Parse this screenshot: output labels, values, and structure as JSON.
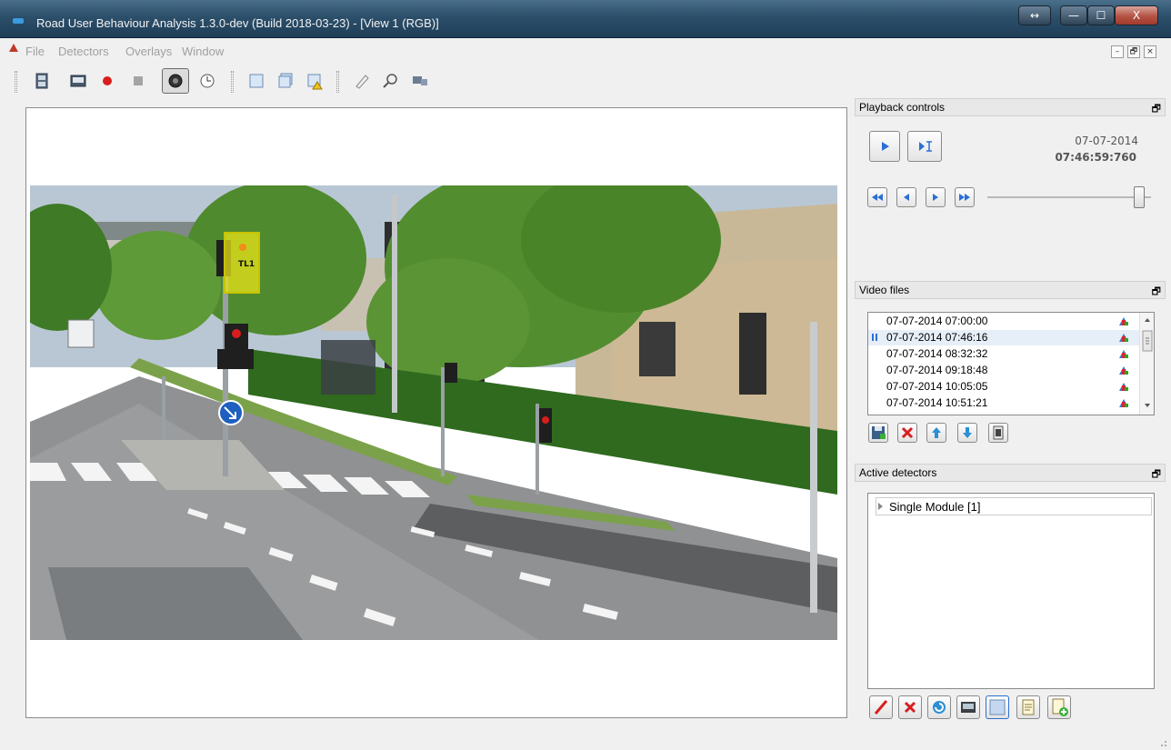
{
  "window": {
    "title": "Road User Behaviour Analysis 1.3.0-dev (Build 2018-03-23) - [View 1 (RGB)]",
    "resize_glyph": "↔",
    "min_glyph": "—",
    "max_glyph": "☐",
    "close_glyph": "X"
  },
  "menu": {
    "items": [
      "File",
      "Detectors",
      "Overlays",
      "Window"
    ]
  },
  "mdi_controls": {
    "minimize": "–",
    "restore": "🗗",
    "close": "×"
  },
  "toolbar": {
    "icons": [
      "film-icon",
      "screen-icon",
      "record-icon",
      "stop-icon",
      "camera-icon",
      "clock-icon",
      "frame-icon",
      "frames-icon",
      "frame-warning-icon",
      "pencil-icon",
      "magnifier-icon",
      "monitor-icon"
    ]
  },
  "video": {
    "overlay_label": "TL1"
  },
  "playback": {
    "title": "Playback controls",
    "date": "07-07-2014",
    "time": "07:46:59:760",
    "slider_position": 0.93
  },
  "video_files": {
    "title": "Video files",
    "items": [
      "07-07-2014 07:00:00",
      "07-07-2014 07:46:16",
      "07-07-2014 08:32:32",
      "07-07-2014 09:18:48",
      "07-07-2014 10:05:05",
      "07-07-2014 10:51:21"
    ],
    "selected_index": 1
  },
  "active_detectors": {
    "title": "Active detectors",
    "items": [
      "Single Module [1]"
    ]
  },
  "colors": {
    "titlebar": "#2c4f6a",
    "accent_blue": "#2a6fd4",
    "record_red": "#d81e1e",
    "yellow_overlay": "#e8e31a"
  }
}
